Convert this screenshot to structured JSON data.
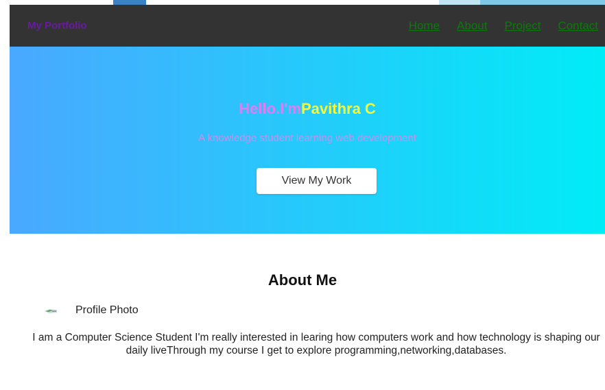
{
  "navbar": {
    "brand": "My Portfolio",
    "links": [
      "Home",
      "About",
      "Project",
      "Contact"
    ]
  },
  "hero": {
    "hello": "Hello.I'm",
    "name": "Pavithra C",
    "subtitle": "A knowledge student learning web development",
    "button_label": "View My Work"
  },
  "about": {
    "title": "About Me",
    "profile_alt": "Profile Photo",
    "paragraph": "I am a Computer Science Student I'm really interested in learing how computers work and how technology is shaping our daily liveThrough my course I get to explore programming,networking,databases."
  },
  "colors": {
    "navbar_bg": "#333333",
    "brand": "#6a1aa0",
    "nav_link": "#0a7a0a",
    "hero_gradient_start": "#4aa8ff",
    "hero_gradient_end": "#00ecf7",
    "hello_text": "#e27cf0",
    "name_text": "#f6f93a",
    "subtitle_text": "#c98fe8"
  },
  "icons": {
    "profile_photo": "broken-image-icon"
  }
}
